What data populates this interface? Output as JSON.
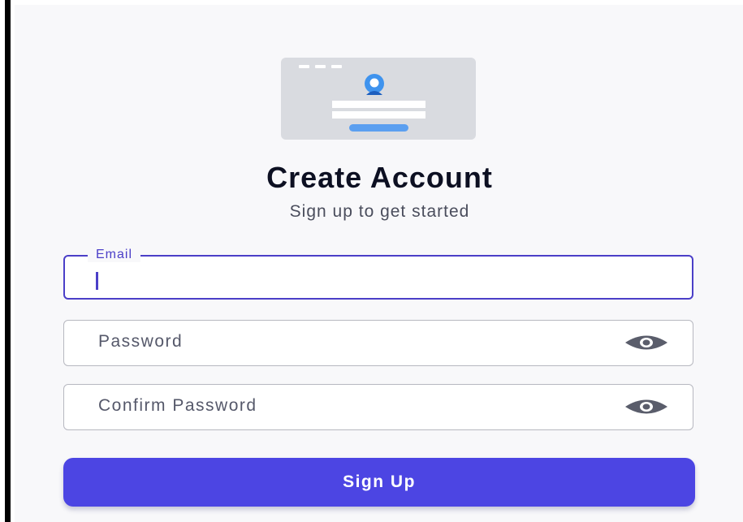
{
  "header": {
    "title": "Create Account",
    "subtitle": "Sign up to get started"
  },
  "hero": {
    "icon": "account-illustration"
  },
  "form": {
    "email": {
      "label": "Email",
      "value": ""
    },
    "password": {
      "placeholder": "Password",
      "toggle_icon": "eye-icon"
    },
    "confirm_password": {
      "placeholder": "Confirm Password",
      "toggle_icon": "eye-icon"
    },
    "submit_label": "Sign Up"
  },
  "colors": {
    "accent": "#4c45e3",
    "focus_border": "#4b3fc8",
    "hero_bg": "#d9dbe0",
    "hero_avatar": "#3f93ee"
  }
}
